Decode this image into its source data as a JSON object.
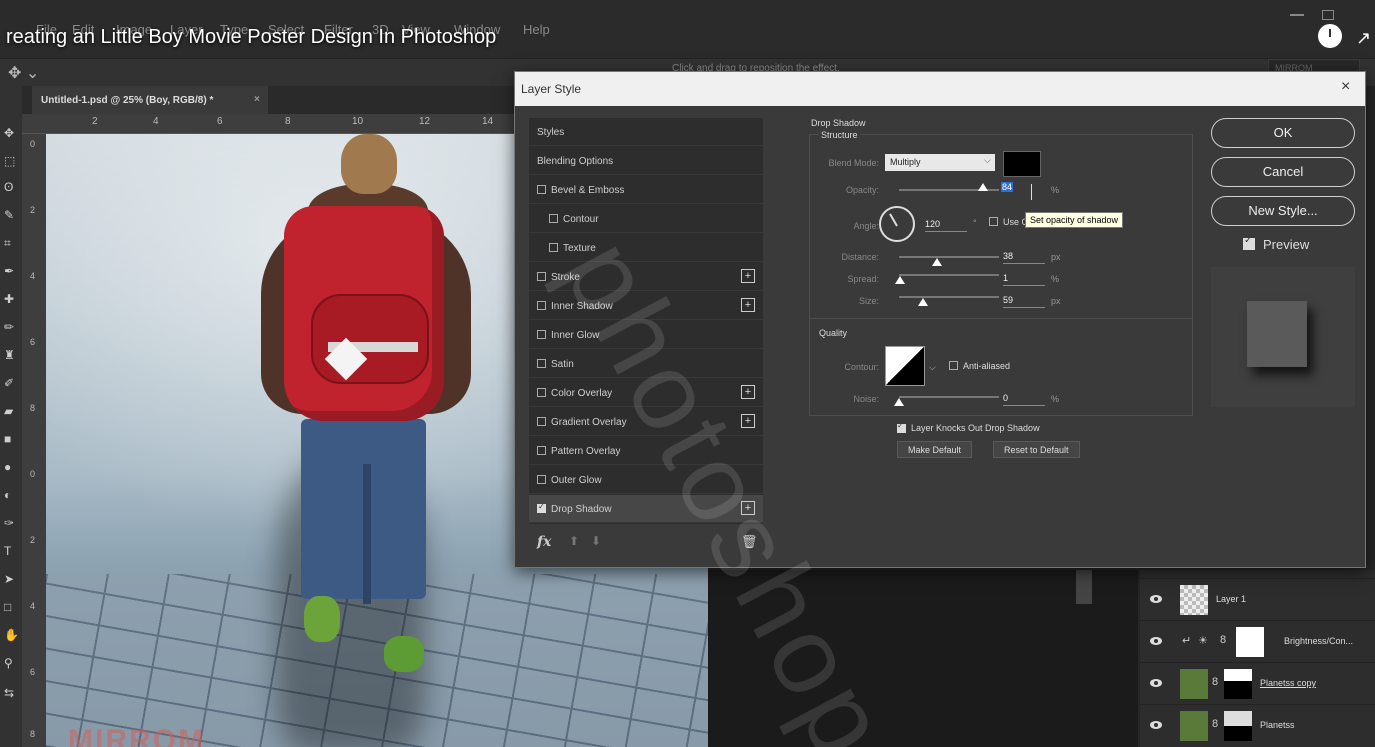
{
  "video_title": "reating an Little Boy Movie Poster Design In Photoshop",
  "menu": [
    "File",
    "Edit",
    "Image",
    "Layer",
    "Type",
    "Select",
    "Filter",
    "3D",
    "View",
    "Window",
    "Help"
  ],
  "options_bar": {
    "hint": "Click and drag to reposition the effect.",
    "search": "MIRROM"
  },
  "document": {
    "tab_label": "Untitled-1.psd @ 25% (Boy, RGB/8) *",
    "tab_close": "×",
    "ruler_top": [
      "2",
      "4",
      "6",
      "8",
      "10",
      "12",
      "14"
    ],
    "ruler_left": [
      "0",
      "2",
      "4",
      "6",
      "8",
      "0",
      "2",
      "4",
      "6",
      "8"
    ],
    "canvas_watermark": "MIRROM"
  },
  "layers": [
    {
      "name": "Layer 1"
    },
    {
      "name": "Brightness/Con..."
    },
    {
      "name": "Planetss copy"
    },
    {
      "name": "Planetss"
    }
  ],
  "dialog": {
    "title": "Layer Style",
    "close": "×",
    "styles": [
      {
        "label": "Styles",
        "checkbox": false,
        "plus": false,
        "indent": 0,
        "header": true
      },
      {
        "label": "Blending Options",
        "checkbox": false,
        "plus": false,
        "indent": 0,
        "header": true
      },
      {
        "label": "Bevel & Emboss",
        "checkbox": true,
        "checked": false,
        "plus": false,
        "indent": 0
      },
      {
        "label": "Contour",
        "checkbox": true,
        "checked": false,
        "plus": false,
        "indent": 1
      },
      {
        "label": "Texture",
        "checkbox": true,
        "checked": false,
        "plus": false,
        "indent": 1
      },
      {
        "label": "Stroke",
        "checkbox": true,
        "checked": false,
        "plus": true,
        "indent": 0
      },
      {
        "label": "Inner Shadow",
        "checkbox": true,
        "checked": false,
        "plus": true,
        "indent": 0
      },
      {
        "label": "Inner Glow",
        "checkbox": true,
        "checked": false,
        "plus": false,
        "indent": 0
      },
      {
        "label": "Satin",
        "checkbox": true,
        "checked": false,
        "plus": false,
        "indent": 0
      },
      {
        "label": "Color Overlay",
        "checkbox": true,
        "checked": false,
        "plus": true,
        "indent": 0
      },
      {
        "label": "Gradient Overlay",
        "checkbox": true,
        "checked": false,
        "plus": true,
        "indent": 0
      },
      {
        "label": "Pattern Overlay",
        "checkbox": true,
        "checked": false,
        "plus": false,
        "indent": 0
      },
      {
        "label": "Outer Glow",
        "checkbox": true,
        "checked": false,
        "plus": false,
        "indent": 0
      },
      {
        "label": "Drop Shadow",
        "checkbox": true,
        "checked": true,
        "plus": true,
        "indent": 0,
        "active": true
      }
    ],
    "fx_label": "fx",
    "drop_shadow": {
      "title": "Drop Shadow",
      "structure_title": "Structure",
      "blend_mode_label": "Blend Mode:",
      "blend_mode": "Multiply",
      "shadow_color": "#000000",
      "opacity_label": "Opacity:",
      "opacity": "84",
      "opacity_unit": "%",
      "angle_label": "Angle:",
      "angle": "120",
      "angle_unit": "°",
      "use_global_label": "Use G",
      "tooltip": "Set opacity of shadow",
      "distance_label": "Distance:",
      "distance": "38",
      "distance_unit": "px",
      "spread_label": "Spread:",
      "spread": "1",
      "spread_unit": "%",
      "size_label": "Size:",
      "size": "59",
      "size_unit": "px",
      "quality_title": "Quality",
      "contour_label": "Contour:",
      "anti_aliased_label": "Anti-aliased",
      "noise_label": "Noise:",
      "noise": "0",
      "noise_unit": "%",
      "knocks_out_label": "Layer Knocks Out Drop Shadow",
      "make_default": "Make Default",
      "reset_default": "Reset to Default"
    },
    "buttons": {
      "ok": "OK",
      "cancel": "Cancel",
      "new_style": "New Style...",
      "preview": "Preview"
    }
  },
  "watermark": "photoshop"
}
